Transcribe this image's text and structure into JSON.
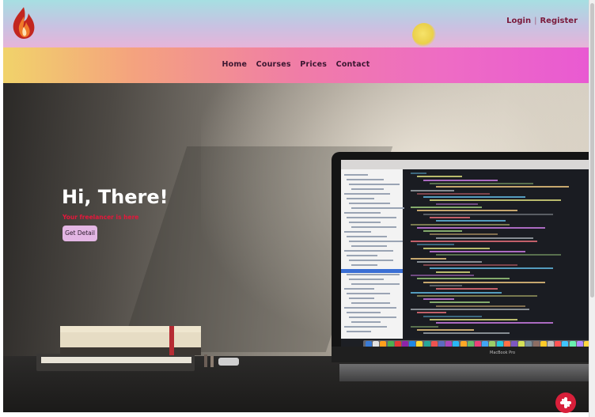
{
  "header": {
    "auth": {
      "login": "Login",
      "separator": "|",
      "register": "Register"
    }
  },
  "nav": {
    "items": [
      "Home",
      "Courses",
      "Prices",
      "Contact"
    ]
  },
  "hero": {
    "headline": "Hi, There!",
    "tagline": "Your freelancer is here",
    "cta": "Get Detail",
    "laptop_brand": "MacBook Pro"
  },
  "colors": {
    "accent_red": "#d81f3a",
    "cta_bg": "#e3b6e4",
    "nav_gradient_start": "#f1d36a",
    "nav_gradient_end": "#e95ad2"
  },
  "icons": [
    "flame-logo-icon",
    "chat-icon"
  ]
}
